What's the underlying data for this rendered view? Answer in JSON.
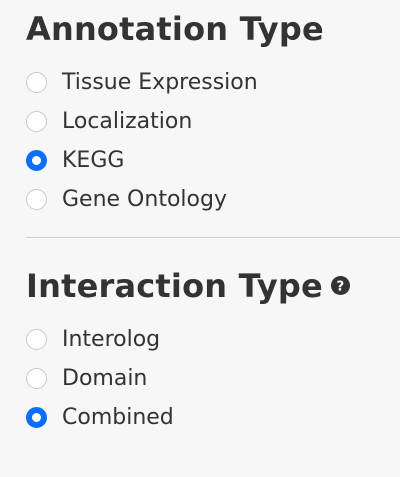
{
  "annotation": {
    "title": "Annotation Type",
    "options": [
      {
        "label": "Tissue Expression",
        "checked": false
      },
      {
        "label": "Localization",
        "checked": false
      },
      {
        "label": "KEGG",
        "checked": true
      },
      {
        "label": "Gene Ontology",
        "checked": false
      }
    ]
  },
  "interaction": {
    "title": "Interaction Type",
    "help_icon": "question-circle-icon",
    "options": [
      {
        "label": "Interolog",
        "checked": false
      },
      {
        "label": "Domain",
        "checked": false
      },
      {
        "label": "Combined",
        "checked": true
      }
    ]
  },
  "colors": {
    "accent": "#0d6efd",
    "text": "#333333",
    "background": "#f7f7f7"
  }
}
